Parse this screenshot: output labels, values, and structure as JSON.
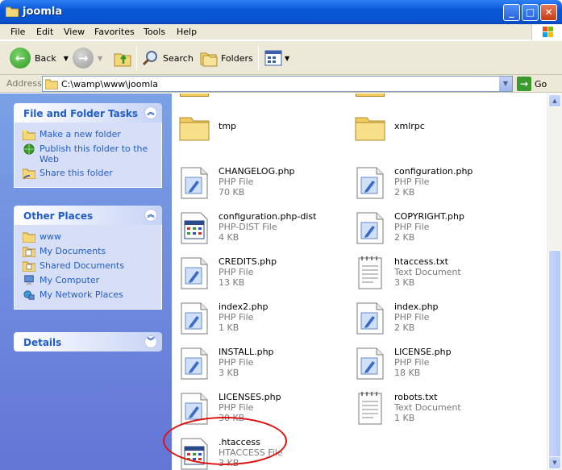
{
  "window": {
    "title": "joomla"
  },
  "menu": [
    "File",
    "Edit",
    "View",
    "Favorites",
    "Tools",
    "Help"
  ],
  "toolbar": {
    "back_label": "Back",
    "search_label": "Search",
    "folders_label": "Folders"
  },
  "address": {
    "label": "Address",
    "value": "C:\\wamp\\www\\joomla",
    "go_label": "Go"
  },
  "tasks_panel": {
    "title": "File and Folder Tasks",
    "items": [
      {
        "label": "Make a new folder",
        "icon": "new-folder-icon"
      },
      {
        "label": "Publish this folder to the Web",
        "icon": "globe-icon"
      },
      {
        "label": "Share this folder",
        "icon": "share-folder-icon"
      }
    ]
  },
  "places_panel": {
    "title": "Other Places",
    "items": [
      {
        "label": "www",
        "icon": "folder-icon"
      },
      {
        "label": "My Documents",
        "icon": "documents-folder-icon"
      },
      {
        "label": "Shared Documents",
        "icon": "shared-folder-icon"
      },
      {
        "label": "My Computer",
        "icon": "computer-icon"
      },
      {
        "label": "My Network Places",
        "icon": "network-icon"
      }
    ]
  },
  "details_panel": {
    "title": "Details"
  },
  "files": [
    {
      "name": "tmp",
      "kind": "folder"
    },
    {
      "name": "xmlrpc",
      "kind": "folder"
    },
    {
      "name": "CHANGELOG.php",
      "type": "PHP File",
      "size": "70 KB",
      "kind": "php"
    },
    {
      "name": "configuration.php",
      "type": "PHP File",
      "size": "2 KB",
      "kind": "php"
    },
    {
      "name": "configuration.php-dist",
      "type": "PHP-DIST File",
      "size": "4 KB",
      "kind": "app"
    },
    {
      "name": "COPYRIGHT.php",
      "type": "PHP File",
      "size": "2 KB",
      "kind": "php"
    },
    {
      "name": "CREDITS.php",
      "type": "PHP File",
      "size": "13 KB",
      "kind": "php"
    },
    {
      "name": "htaccess.txt",
      "type": "Text Document",
      "size": "3 KB",
      "kind": "txt"
    },
    {
      "name": "index2.php",
      "type": "PHP File",
      "size": "1 KB",
      "kind": "php"
    },
    {
      "name": "index.php",
      "type": "PHP File",
      "size": "2 KB",
      "kind": "php"
    },
    {
      "name": "INSTALL.php",
      "type": "PHP File",
      "size": "3 KB",
      "kind": "php"
    },
    {
      "name": "LICENSE.php",
      "type": "PHP File",
      "size": "18 KB",
      "kind": "php"
    },
    {
      "name": "LICENSES.php",
      "type": "PHP File",
      "size": "30 KB",
      "kind": "php"
    },
    {
      "name": "robots.txt",
      "type": "Text Document",
      "size": "1 KB",
      "kind": "txt"
    },
    {
      "name": ".htaccess",
      "type": "HTACCESS File",
      "size": "3 KB",
      "kind": "app"
    }
  ],
  "colors": {
    "title_bar": "#0a58d8",
    "task_pane": "#6f8ee0",
    "link": "#215dc6",
    "annotation": "#e01010"
  }
}
